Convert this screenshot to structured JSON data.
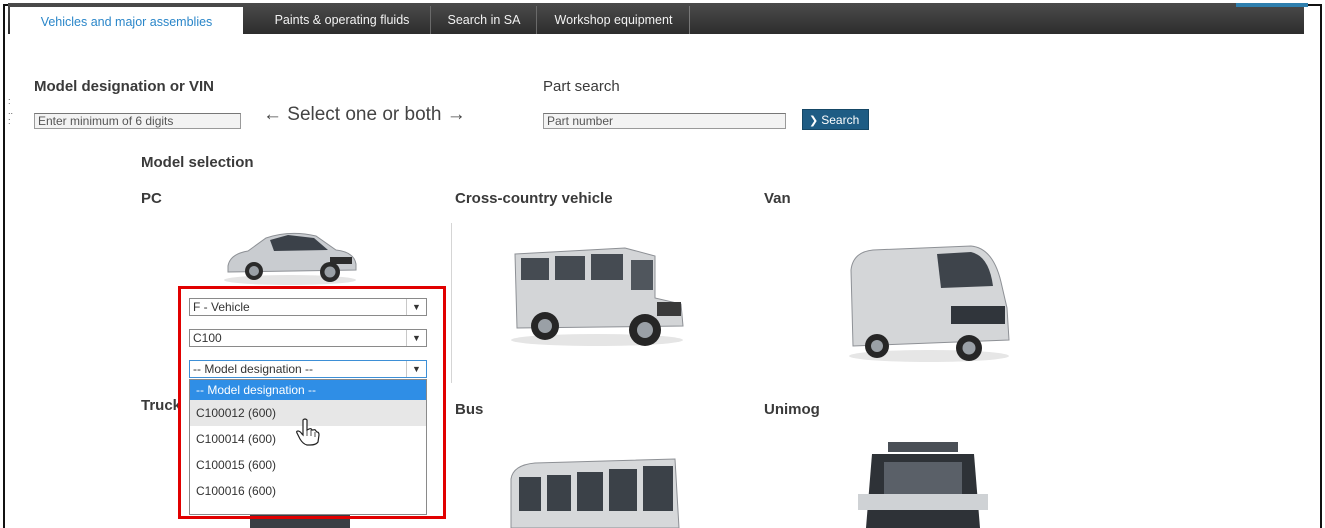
{
  "tabs": [
    {
      "label": "Vehicles and major assemblies",
      "active": true
    },
    {
      "label": "Paints & operating fluids",
      "active": false
    },
    {
      "label": "Search in SA",
      "active": false
    },
    {
      "label": "Workshop equipment",
      "active": false
    }
  ],
  "model_vin": {
    "label": "Model designation or VIN",
    "placeholder": "Enter minimum of 6 digits"
  },
  "hint": "← Select one or both →",
  "part_search": {
    "label": "Part search",
    "placeholder": "Part number",
    "button_label": "Search"
  },
  "model_selection": {
    "heading": "Model selection",
    "categories": {
      "pc": "PC",
      "cross_country": "Cross-country vehicle",
      "van": "Van",
      "truck": "Truck",
      "bus": "Bus",
      "unimog": "Unimog"
    }
  },
  "dropdowns": {
    "vehicle_type": "F - Vehicle",
    "class": "C100",
    "model_designation": "-- Model designation --"
  },
  "model_options": [
    "-- Model designation --",
    "C100012 (600)",
    "C100014 (600)",
    "C100015 (600)",
    "C100016 (600)"
  ],
  "colors": {
    "accent_blue": "#2f8ee6",
    "button_blue": "#1e5c84",
    "highlight_red": "#e10000",
    "tab_bar": "#3a3a3a"
  }
}
